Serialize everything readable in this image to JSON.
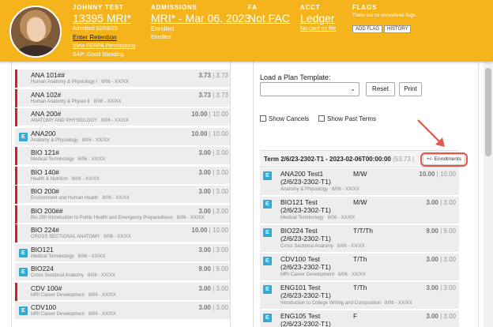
{
  "header": {
    "student": {
      "label": "JOHNNY TEST",
      "id": "13395 MRI*",
      "admitted": "Admitted 02/06/23",
      "retention": "Enter Retention",
      "ferpa": "View FERPA Permissions",
      "sap": "SAP: Good Standing"
    },
    "admissions": {
      "label": "ADMISSIONS",
      "program": "MRI* - Mar 06, 2023",
      "status1": "Enrolled",
      "status2": "Enrolled"
    },
    "fa": {
      "label": "FA",
      "value": "Not FAC"
    },
    "acct": {
      "label": "ACCT",
      "value": "Ledger",
      "card": "No card on file"
    },
    "flags": {
      "label": "FLAGS",
      "note": "There are no unresolved flags.",
      "add": "ADD FLAG",
      "history": "HISTORY"
    }
  },
  "left_courses": [
    {
      "code": "ANA 101##",
      "name": "Human Anatomy & Physiology I",
      "dates": "8/06 - XX/XX",
      "earned": "3.73",
      "total": "3.73",
      "red": true,
      "badge": ""
    },
    {
      "code": "ANA 102#",
      "name": "Human Anatomy & Physio II",
      "dates": "8/06 - XX/XX",
      "earned": "3.73",
      "total": "3.73",
      "red": true,
      "badge": ""
    },
    {
      "code": "ANA 200#",
      "name": "ANATOMY AND PHYSIOLOGY",
      "dates": "8/06 - XX/XX",
      "earned": "10.00",
      "total": "10.00",
      "red": true,
      "badge": ""
    },
    {
      "code": "ANA200",
      "name": "Anatomy & Physiology",
      "dates": "8/06 - XX/XX",
      "earned": "10.00",
      "total": "10.00",
      "red": false,
      "badge": "E"
    },
    {
      "code": "BIO 121#",
      "name": "Medical Terminology",
      "dates": "8/06 - XX/XX",
      "earned": "3.00",
      "total": "3.00",
      "red": true,
      "badge": ""
    },
    {
      "code": "BIO 140#",
      "name": "Health & Nutrition",
      "dates": "8/06 - XX/XX",
      "earned": "3.00",
      "total": "3.00",
      "red": true,
      "badge": ""
    },
    {
      "code": "BIO 200#",
      "name": "Environment and Human Health",
      "dates": "8/06 - XX/XX",
      "earned": "3.00",
      "total": "3.00",
      "red": true,
      "badge": ""
    },
    {
      "code": "BIO 200##",
      "name": "Bio 200 Introduction to Public Health and Emergency Preparedness",
      "dates": "8/06 - XX/XX",
      "earned": "3.00",
      "total": "3.00",
      "red": true,
      "badge": ""
    },
    {
      "code": "BIO 224#",
      "name": "CROSS SECTIONAL ANATOMY",
      "dates": "8/06 - XX/XX",
      "earned": "10.00",
      "total": "10.00",
      "red": true,
      "badge": ""
    },
    {
      "code": "BIO121",
      "name": "Medical Terminology",
      "dates": "8/06 - XX/XX",
      "earned": "3.00",
      "total": "3.00",
      "red": false,
      "badge": "E"
    },
    {
      "code": "BIO224",
      "name": "Cross Sectional Anatomy",
      "dates": "8/06 - XX/XX",
      "earned": "9.00",
      "total": "9.00",
      "red": false,
      "badge": "E"
    },
    {
      "code": "CDV 100#",
      "name": "MRI Career Development",
      "dates": "8/06 - XX/XX",
      "earned": "3.00",
      "total": "3.00",
      "red": true,
      "badge": ""
    },
    {
      "code": "CDV100",
      "name": "MRI Career Development",
      "dates": "8/06 - XX/XX",
      "earned": "3.00",
      "total": "3.00",
      "red": false,
      "badge": "E"
    }
  ],
  "plan": {
    "template_label": "Load a Plan Template:",
    "reset": "Reset",
    "print": "Print",
    "show_cancels": "Show Cancels",
    "show_past_terms": "Show Past Terms"
  },
  "term": {
    "title": "Term 2/6/23-2302-T1 - 2023-02-06T00:00:00",
    "credits": "(53.73 |",
    "enroll_btn": "+/- Enrollments"
  },
  "term_courses": [
    {
      "line1": "ANA200 Test1",
      "line2": "(2/6/23-2302-T1)",
      "name": "Anatomy & Physiology",
      "dates": "8/06 - XX/XX",
      "days": "M/W",
      "earned": "10.00",
      "total": "10.00"
    },
    {
      "line1": "BIO121 Test",
      "line2": "(2/6/23-2302-T1)",
      "name": "Medical Terminology",
      "dates": "8/06 - XX/XX",
      "days": "M/W",
      "earned": "3.00",
      "total": "3.00"
    },
    {
      "line1": "BIO224 Test",
      "line2": "(2/6/23-2302-T1)",
      "name": "Cross Sectional Anatomy",
      "dates": "8/06 - XX/XX",
      "days": "T/T/Th",
      "earned": "9.00",
      "total": "9.00"
    },
    {
      "line1": "CDV100 Test",
      "line2": "(2/6/23-2302-T1)",
      "name": "MRI Career Development",
      "dates": "8/06 - XX/XX",
      "days": "T/Th",
      "earned": "3.00",
      "total": "3.00"
    },
    {
      "line1": "ENG101 Test",
      "line2": "(2/6/23-2302-T1)",
      "name": "Introduction to College Writing and Composition",
      "dates": "8/06 - XX/XX",
      "days": "T/Th",
      "earned": "3.00",
      "total": "3.00"
    },
    {
      "line1": "ENG105 Test",
      "line2": "(2/6/23-2302-T1)",
      "name": "",
      "dates": "",
      "days": "F",
      "earned": "3.00",
      "total": "3.00"
    }
  ],
  "colors": {
    "header": "#f5b41c",
    "red_bar": "#d41e2b",
    "badge": "#35a9d6",
    "highlight": "#e2584a"
  }
}
